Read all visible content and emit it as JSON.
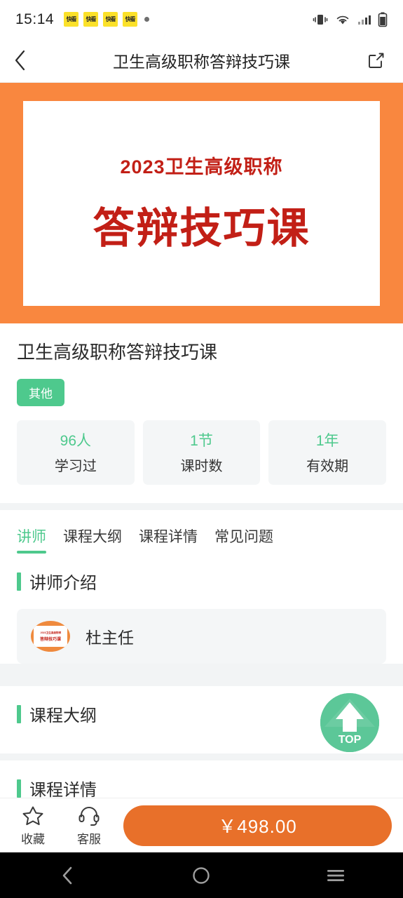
{
  "status_bar": {
    "time": "15:14",
    "badges": [
      "快看",
      "快看",
      "快看",
      "快看"
    ],
    "icons": [
      "vibrate-icon",
      "wifi-icon",
      "signal-icon",
      "battery-icon"
    ]
  },
  "app_bar": {
    "back_icon": "chevron-left-icon",
    "title": "卫生高级职称答辩技巧课",
    "share_icon": "share-icon"
  },
  "banner": {
    "subtitle": "2023卫生高级职称",
    "main_title": "答辩技巧课",
    "background_color": "#f9873f",
    "text_color": "#c21f16"
  },
  "course": {
    "title": "卫生高级职称答辩技巧课",
    "tag": "其他",
    "tag_color": "#4ec98d",
    "stats": [
      {
        "value": "96人",
        "label": "学习过"
      },
      {
        "value": "1节",
        "label": "课时数"
      },
      {
        "value": "1年",
        "label": "有效期"
      }
    ]
  },
  "tabs": [
    {
      "label": "讲师",
      "active": true
    },
    {
      "label": "课程大纲",
      "active": false
    },
    {
      "label": "课程详情",
      "active": false
    },
    {
      "label": "常见问题",
      "active": false
    }
  ],
  "sections": {
    "instructor": {
      "heading": "讲师介绍",
      "teacher": {
        "name": "杜主任",
        "avatar_line1": "2023卫生高级职称",
        "avatar_line2": "答辩技巧课"
      }
    },
    "outline": {
      "heading": "课程大纲"
    },
    "detail": {
      "heading": "课程详情"
    }
  },
  "top_button": {
    "label": "TOP",
    "icon": "arrow-up-icon",
    "color": "#5cc798"
  },
  "bottom_bar": {
    "favorite": {
      "icon": "star-icon",
      "label": "收藏"
    },
    "support": {
      "icon": "headset-icon",
      "label": "客服"
    },
    "buy_button": {
      "label": "￥498.00",
      "color": "#e8702a"
    }
  },
  "android_nav": {
    "back_icon": "nav-back-icon",
    "home_icon": "nav-home-icon",
    "recents_icon": "nav-recents-icon"
  }
}
